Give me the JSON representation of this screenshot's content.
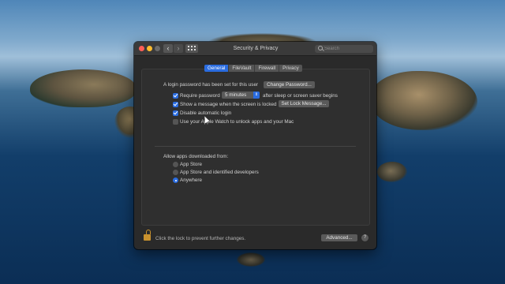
{
  "window": {
    "title": "Security & Privacy"
  },
  "search": {
    "placeholder": "Search"
  },
  "tabs": [
    {
      "label": "General"
    },
    {
      "label": "FileVault"
    },
    {
      "label": "Firewall"
    },
    {
      "label": "Privacy"
    }
  ],
  "general": {
    "login_password_text": "A login password has been set for this user",
    "change_password_label": "Change Password...",
    "require_password_label": "Require password",
    "require_password_value": "5 minutes",
    "require_password_suffix": "after sleep or screen saver begins",
    "show_message_label": "Show a message when the screen is locked",
    "set_lock_message_label": "Set Lock Message...",
    "disable_auto_login_label": "Disable automatic login",
    "apple_watch_label": "Use your Apple Watch to unlock apps and your Mac",
    "checkboxes": {
      "require_password": true,
      "show_message": true,
      "disable_auto_login": true,
      "apple_watch": false
    },
    "allow_apps_heading": "Allow apps downloaded from:",
    "allow_options": [
      {
        "label": "App Store",
        "selected": false
      },
      {
        "label": "App Store and identified developers",
        "selected": false
      },
      {
        "label": "Anywhere",
        "selected": true
      }
    ]
  },
  "footer": {
    "lock_text": "Click the lock to prevent further changes.",
    "advanced_label": "Advanced...",
    "help_label": "?"
  },
  "colors": {
    "accent": "#2a6ce0",
    "window_bg": "#2a2a2a",
    "lock": "#c9922e"
  }
}
